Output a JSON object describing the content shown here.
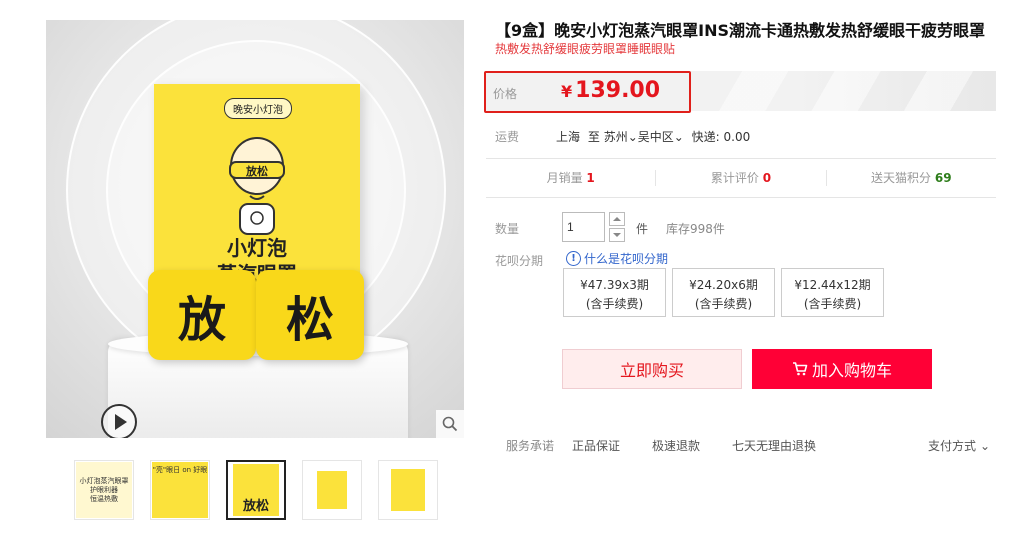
{
  "product": {
    "title": "【9盒】晚安小灯泡蒸汽眼罩INS潮流卡通热敷发热舒缓眼干疲劳眼罩",
    "subtitle": "热敷发热舒缓眼疲劳眼罩睡眠眼贴"
  },
  "gallery": {
    "box_brand": "晚安小灯泡",
    "box_line1": "小灯泡",
    "box_line2": "蒸汽眼罩",
    "box_badge": "放松",
    "pack_left": "放",
    "pack_right": "松",
    "thumb1_text": "小灯泡蒸汽眼罩\n护眼利器\n恒温热敷",
    "thumb2_text": "\"亮\"眼日 on 好眼"
  },
  "price": {
    "label": "价格",
    "currency": "¥",
    "value": "139.00"
  },
  "shipping": {
    "label": "运费",
    "from": "上海",
    "to_word": "至",
    "city": "苏州",
    "district": "吴中区",
    "express": "快递: 0.00"
  },
  "stats": {
    "monthly_sales_label": "月销量",
    "monthly_sales": "1",
    "reviews_label": "累计评价",
    "reviews": "0",
    "points_label": "送天猫积分",
    "points": "69"
  },
  "quantity": {
    "label": "数量",
    "value": "1",
    "unit": "件",
    "stock": "库存998件"
  },
  "huabei": {
    "label": "花呗分期",
    "help": "什么是花呗分期",
    "plans": [
      {
        "amount": "¥47.39x3期",
        "fee": "(含手续费)"
      },
      {
        "amount": "¥24.20x6期",
        "fee": "(含手续费)"
      },
      {
        "amount": "¥12.44x12期",
        "fee": "(含手续费)"
      }
    ]
  },
  "actions": {
    "buy_now": "立即购买",
    "add_cart": "加入购物车"
  },
  "service": {
    "label": "服务承诺",
    "items": [
      "正品保证",
      "极速退款",
      "七天无理由退换"
    ],
    "payment": "支付方式"
  },
  "colors": {
    "accent_red": "#ff0036",
    "price_red": "#e4161e",
    "product_yellow": "#fbe23b"
  }
}
